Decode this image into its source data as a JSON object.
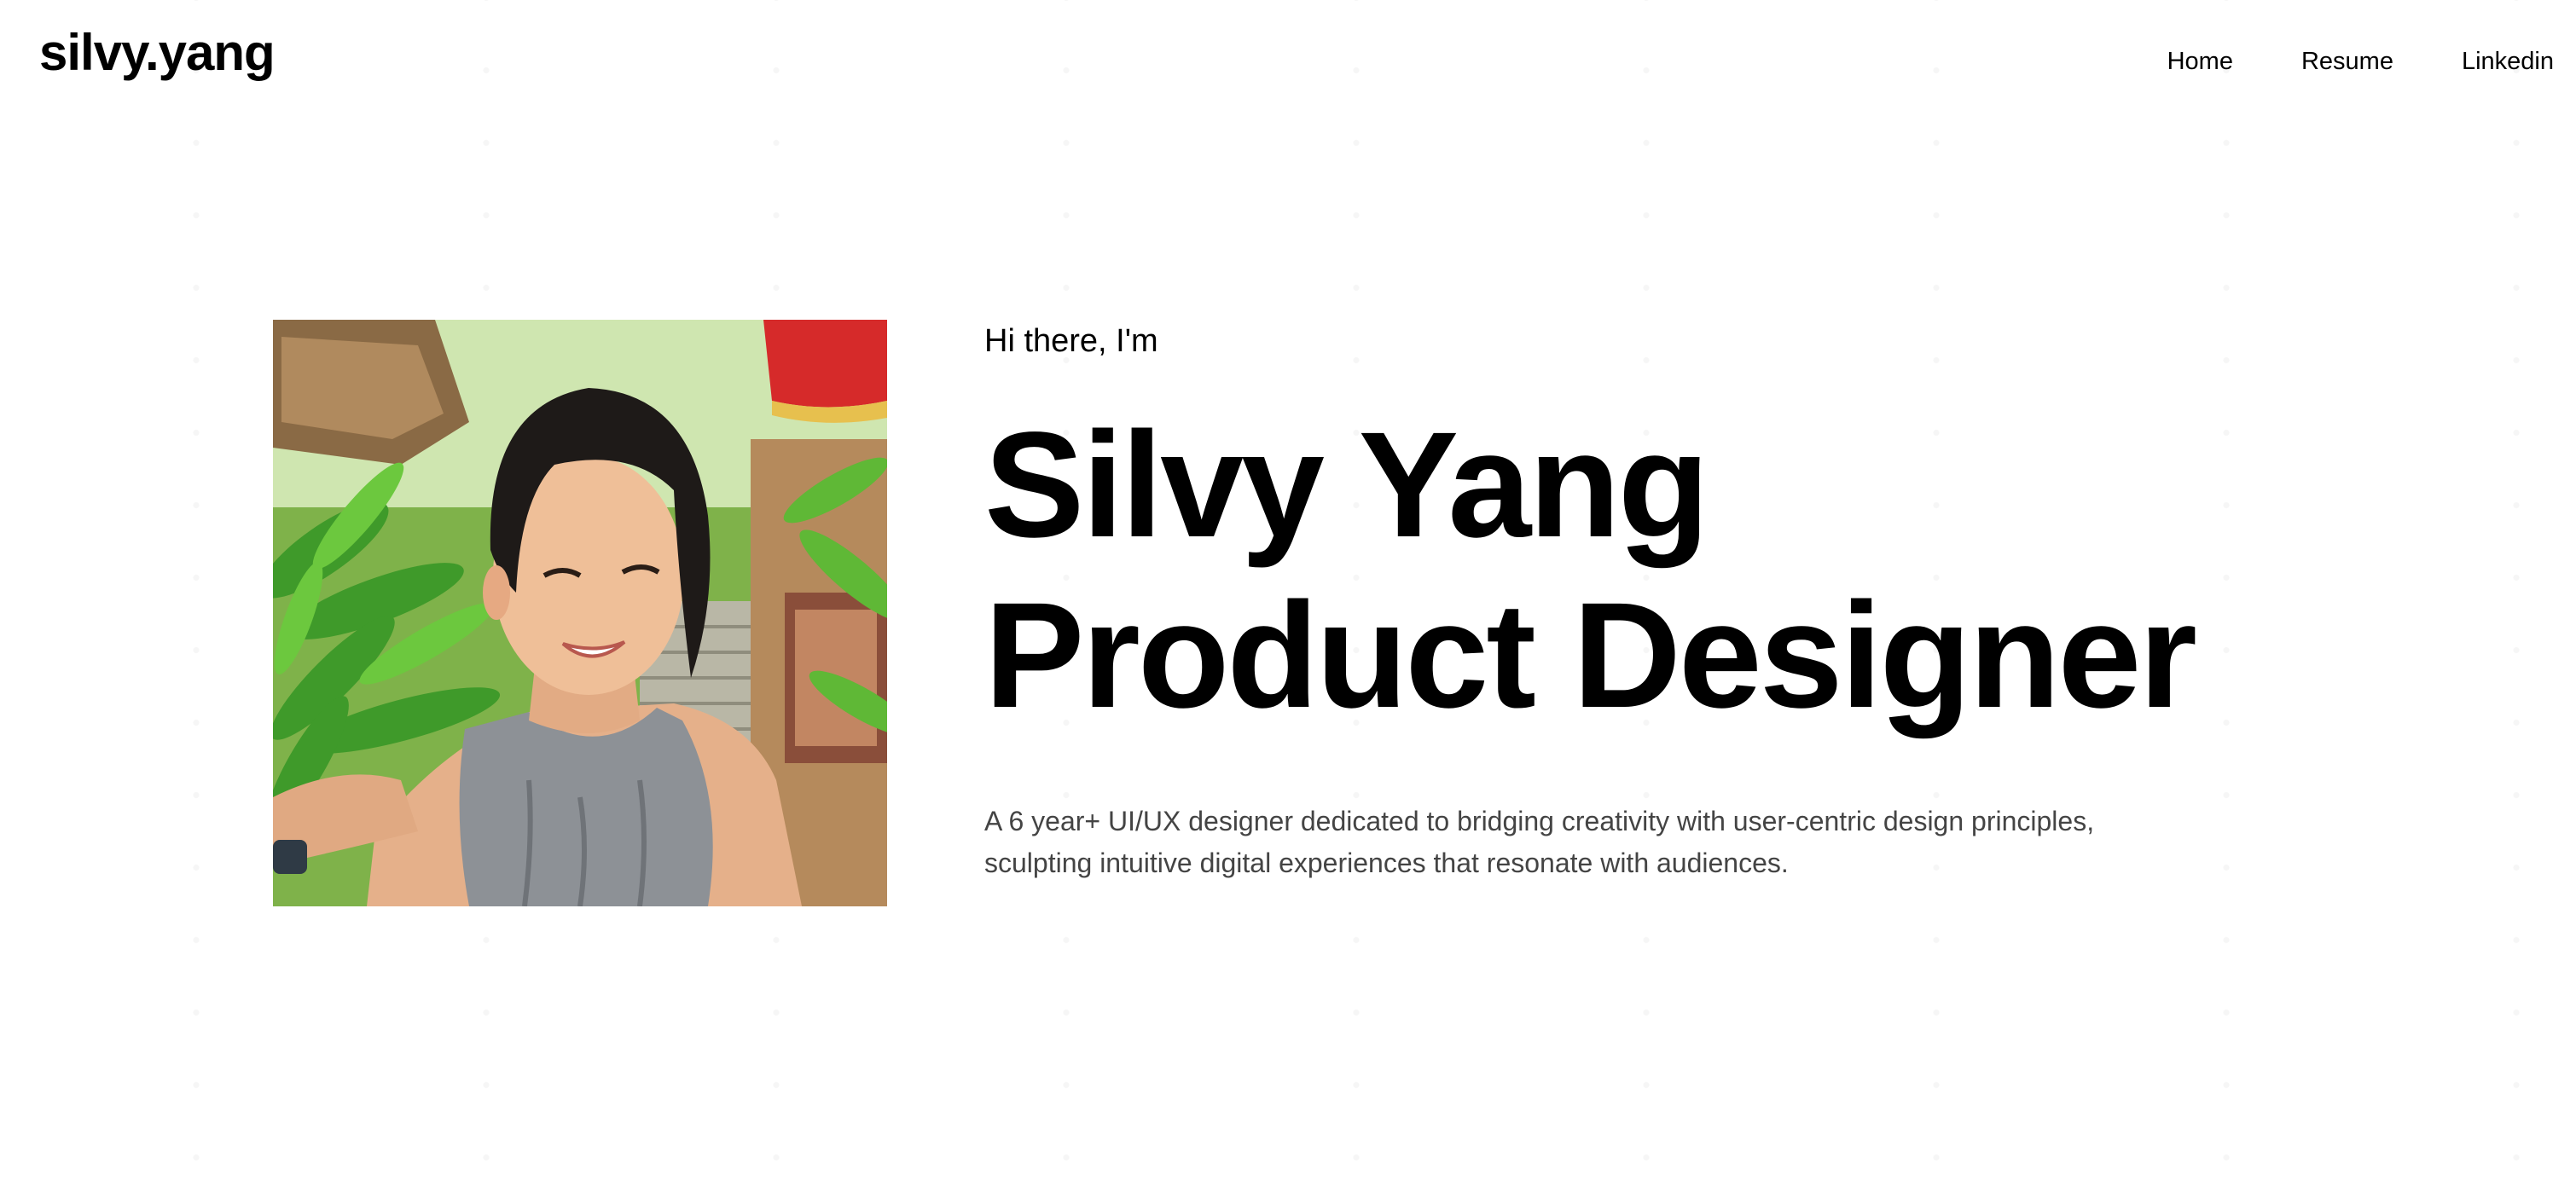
{
  "header": {
    "logo": "silvy.yang",
    "nav": {
      "home": "Home",
      "resume": "Resume",
      "linkedin": "Linkedin"
    }
  },
  "hero": {
    "greeting": "Hi there, I'm",
    "name_line": "Silvy Yang",
    "title_line": "Product Designer",
    "bio": "A 6 year+ UI/UX designer dedicated to bridging creativity with user-centric design principles, sculpting intuitive digital experiences that resonate with audiences."
  },
  "colors": {
    "background": "#ffffff",
    "text": "#000000",
    "bio_text": "#444444"
  }
}
